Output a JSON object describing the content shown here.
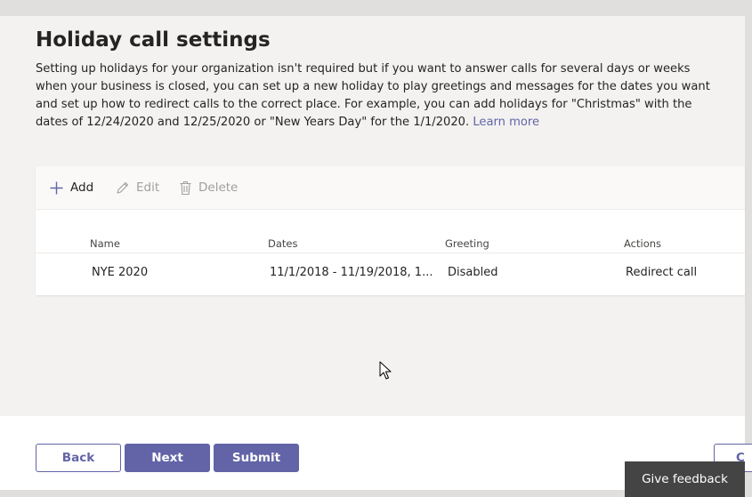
{
  "page": {
    "title": "Holiday call settings",
    "description": "Setting up holidays for your organization isn't required but if you want to answer calls for several days or weeks when your business is closed, you can set up a new holiday to play greetings and messages for the dates you want and set up how to redirect calls to the correct place. For example, you can add holidays for \"Christmas\" with the dates of 12/24/2020 and 12/25/2020 or \"New Years Day\" for the 1/1/2020.",
    "learn_more": "Learn more"
  },
  "toolbar": {
    "add_label": "Add",
    "edit_label": "Edit",
    "delete_label": "Delete"
  },
  "table": {
    "columns": [
      "Name",
      "Dates",
      "Greeting",
      "Actions"
    ],
    "rows": [
      {
        "name": "NYE 2020",
        "dates": "11/1/2018 - 11/19/2018, 1...",
        "greeting": "Disabled",
        "action": "Redirect call"
      }
    ]
  },
  "footer": {
    "back_label": "Back",
    "next_label": "Next",
    "submit_label": "Submit",
    "partial_label": "C"
  },
  "feedback": {
    "label": "Give feedback"
  },
  "colors": {
    "accent": "#6264a7",
    "background": "#f3f2f1",
    "feedback_bg": "#444444"
  },
  "icons": {
    "add": "plus-icon",
    "edit": "pencil-icon",
    "delete": "trash-icon",
    "cursor": "mouse-pointer-icon"
  }
}
